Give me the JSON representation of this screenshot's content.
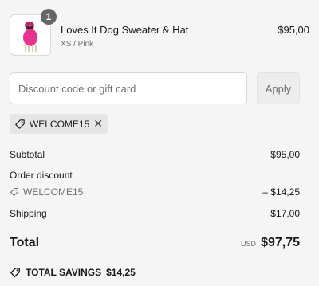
{
  "product": {
    "quantity": "1",
    "name": "Loves It Dog Sweater & Hat",
    "variant": "XS / Pink",
    "price": "$95,00"
  },
  "discount": {
    "placeholder": "Discount code or gift card",
    "apply_label": "Apply",
    "applied_code": "WELCOME15"
  },
  "summary": {
    "subtotal_label": "Subtotal",
    "subtotal_value": "$95,00",
    "order_discount_label": "Order discount",
    "discount_code": "WELCOME15",
    "discount_value": "– $14,25",
    "shipping_label": "Shipping",
    "shipping_value": "$17,00",
    "total_label": "Total",
    "currency": "USD",
    "total_value": "$97,75"
  },
  "savings": {
    "label": "TOTAL SAVINGS",
    "value": "$14,25"
  },
  "colors": {
    "background": "#f5f5f5",
    "badge": "#666666",
    "product_pink": "#e8328f"
  }
}
